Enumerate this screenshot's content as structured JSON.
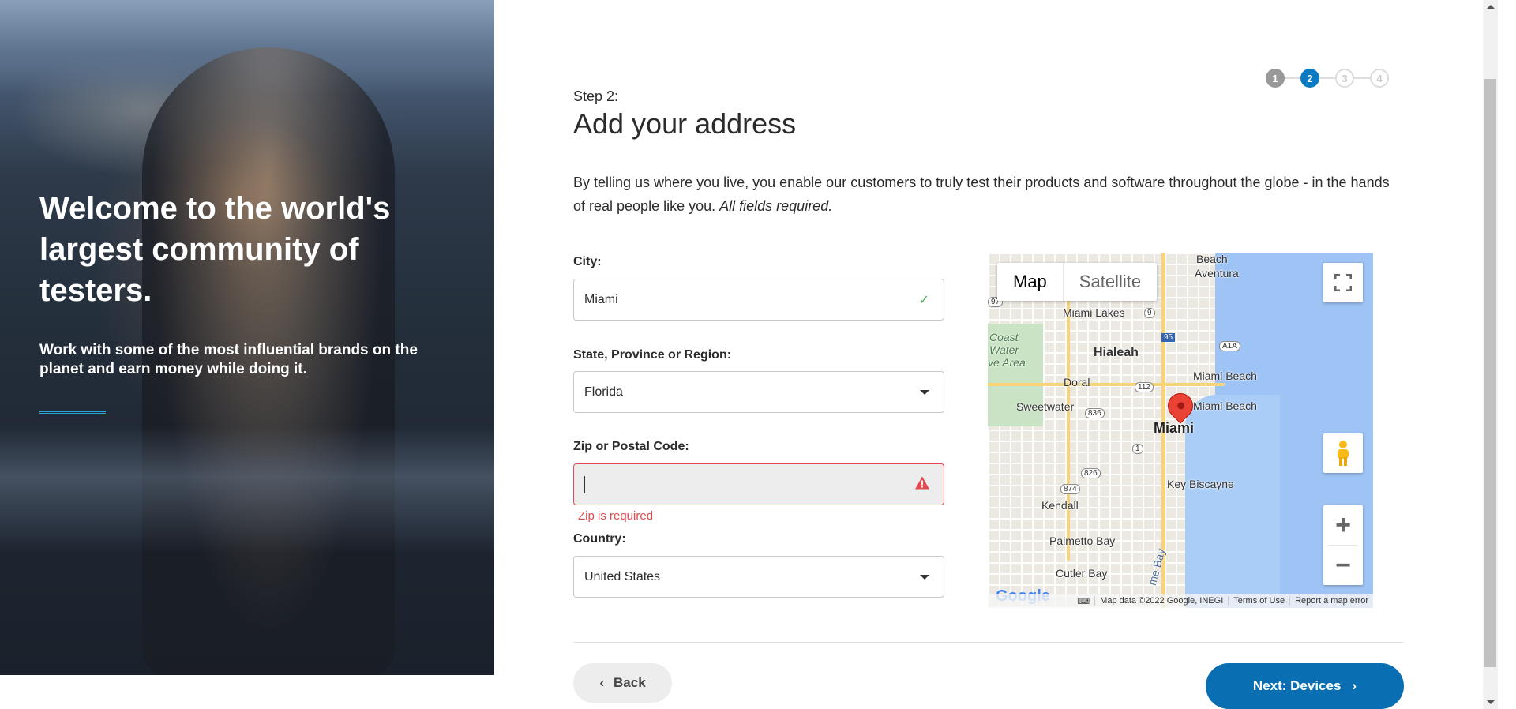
{
  "hero": {
    "heading": "Welcome to the world's largest community of testers.",
    "subheading": "Work with some of the most influential brands on the planet and earn money while doing it."
  },
  "stepper": {
    "steps": [
      "1",
      "2",
      "3",
      "4"
    ],
    "current": 2
  },
  "page": {
    "step_label": "Step 2:",
    "title": "Add your address",
    "intro": "By telling us where you live, you enable our customers to truly test their products and software throughout the globe - in the hands of real people like you.",
    "intro_emphasis": "All fields required."
  },
  "form": {
    "city_label": "City:",
    "city_value": "Miami",
    "state_label": "State, Province or Region:",
    "state_value": "Florida",
    "zip_label": "Zip or Postal Code:",
    "zip_value": "",
    "zip_error": "Zip is required",
    "country_label": "Country:",
    "country_value": "United States"
  },
  "map": {
    "type_map": "Map",
    "type_satellite": "Satellite",
    "labels": {
      "beach": "Beach",
      "aventura": "Aventura",
      "miami_lakes": "Miami Lakes",
      "coast1": "Coast",
      "coast2": "Water",
      "coast3": "ve Area",
      "hialeah": "Hialeah",
      "doral": "Doral",
      "miami_beach1": "Miami Beach",
      "miami_beach2": "Miami Beach",
      "sweetwater": "Sweetwater",
      "miami": "Miami",
      "key_biscayne": "Key Biscayne",
      "kendall": "Kendall",
      "palmetto_bay": "Palmetto Bay",
      "cutler_bay": "Cutler Bay",
      "bay": "me Bay",
      "shield_9": "9",
      "shield_95": "95",
      "shield_a1a": "A1A",
      "shield_112": "112",
      "shield_836": "836",
      "shield_1": "1",
      "shield_826": "826",
      "shield_874": "874",
      "shield_97": "97"
    },
    "attribution": {
      "data": "Map data ©2022 Google, INEGI",
      "terms": "Terms of Use",
      "report": "Report a map error"
    },
    "logo": "Google"
  },
  "nav": {
    "back_label": "Back",
    "next_label": "Next: Devices"
  },
  "colors": {
    "accent": "#0a6fb2",
    "error": "#e5484d",
    "success": "#4caf50"
  }
}
